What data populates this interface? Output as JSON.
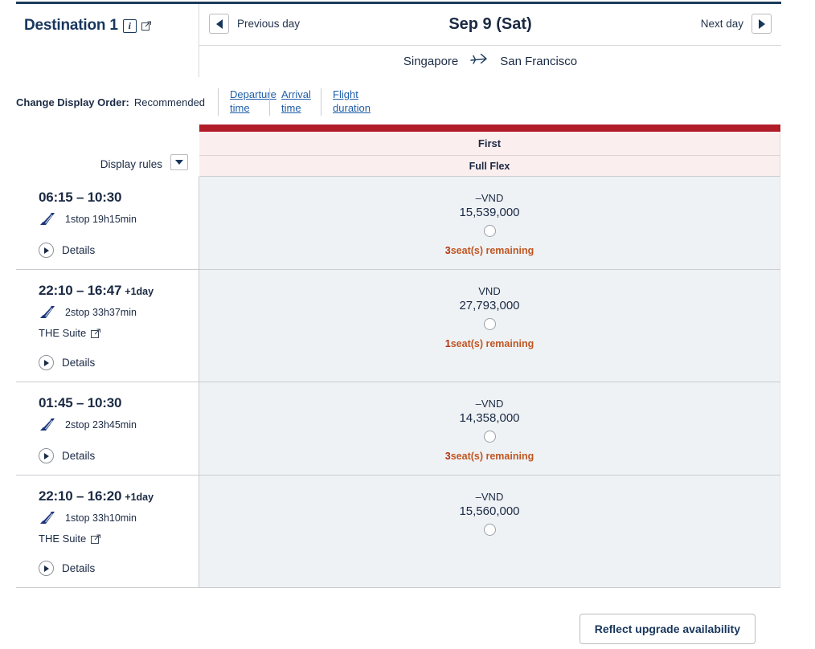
{
  "header": {
    "destination_title": "Destination 1",
    "info_icon": "info-icon",
    "external_link_icon": "external-link-icon",
    "previous_day_label": "Previous day",
    "next_day_label": "Next day",
    "date_label": "Sep 9 (Sat)",
    "origin": "Singapore",
    "destination": "San Francisco",
    "plane_icon": "airplane-icon"
  },
  "display_order": {
    "label": "Change Display Order:",
    "current": "Recommended",
    "options": [
      {
        "label": "Departure time"
      },
      {
        "label": "Arrival time"
      },
      {
        "label": "Flight duration"
      }
    ]
  },
  "display_rules": {
    "label": "Display rules",
    "dropdown_icon": "chevron-down-icon"
  },
  "fare_column": {
    "cabin": "First",
    "fare_type": "Full Flex",
    "band_color": "#b01c28",
    "header_bg": "#fbeeee"
  },
  "details_label": "Details",
  "suite_label": "THE Suite",
  "flights": [
    {
      "time": "06:15 – 10:30",
      "next_day": "",
      "airline_icon": "ana-logo-icon",
      "stops": "1stop 19h15min",
      "suite": "",
      "currency": "–VND",
      "amount": "15,539,000",
      "seats_count": "3",
      "seats_text": "seat(s) remaining"
    },
    {
      "time": "22:10 – 16:47",
      "next_day": "+1day",
      "airline_icon": "ana-logo-icon",
      "stops": "2stop 33h37min",
      "suite": "THE Suite",
      "currency": "VND",
      "amount": "27,793,000",
      "seats_count": "1",
      "seats_text": "seat(s) remaining"
    },
    {
      "time": "01:45 – 10:30",
      "next_day": "",
      "airline_icon": "ana-logo-icon",
      "stops": "2stop 23h45min",
      "suite": "",
      "currency": "–VND",
      "amount": "14,358,000",
      "seats_count": "3",
      "seats_text": "seat(s) remaining"
    },
    {
      "time": "22:10 – 16:20",
      "next_day": "+1day",
      "airline_icon": "ana-logo-icon",
      "stops": "1stop 33h10min",
      "suite": "THE Suite",
      "currency": "–VND",
      "amount": "15,560,000",
      "seats_count": "",
      "seats_text": ""
    }
  ],
  "footer": {
    "reflect_button": "Reflect upgrade availability"
  }
}
